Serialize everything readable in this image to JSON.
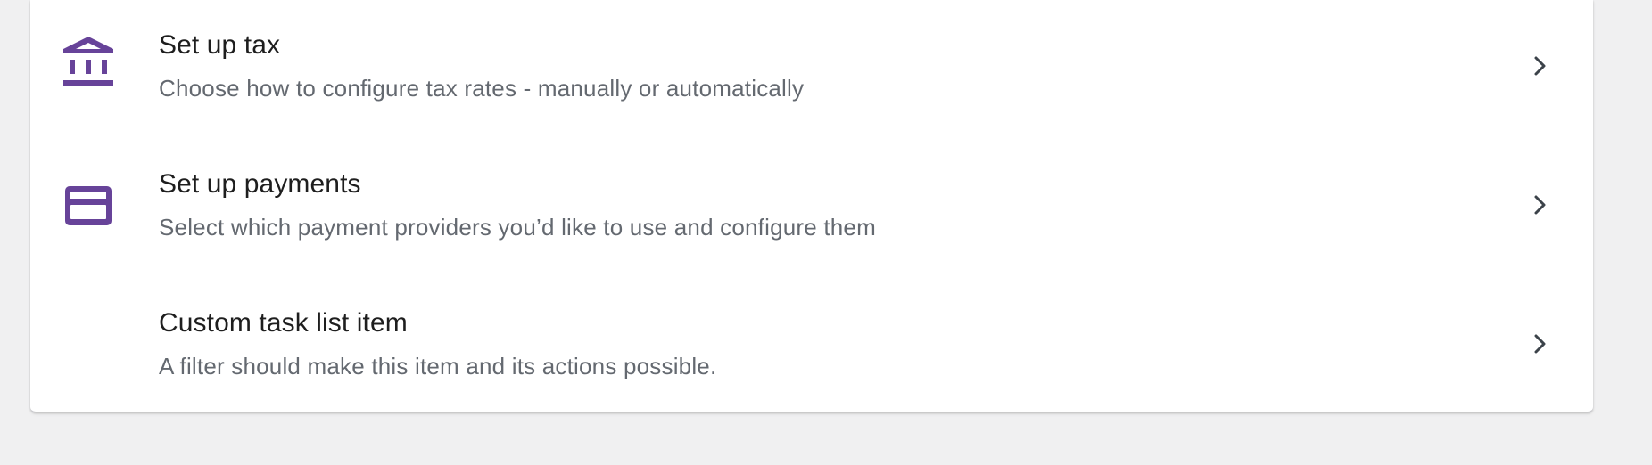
{
  "colors": {
    "accent": "#674399",
    "title": "#1e1e1e",
    "description": "#646970",
    "chevron": "#3c434a",
    "background": "#f0f0f1",
    "card": "#ffffff"
  },
  "tasks": [
    {
      "title": "Set up tax",
      "description": "Choose how to configure tax rates - manually or automatically",
      "icon": "bank-icon",
      "action_icon": "chevron-right-icon"
    },
    {
      "title": "Set up payments",
      "description": "Select which payment providers you’d like to use and configure them",
      "icon": "credit-card-icon",
      "action_icon": "chevron-right-icon"
    },
    {
      "title": "Custom task list item",
      "description": "A filter should make this item and its actions possible.",
      "icon": "",
      "action_icon": "chevron-right-icon"
    }
  ]
}
